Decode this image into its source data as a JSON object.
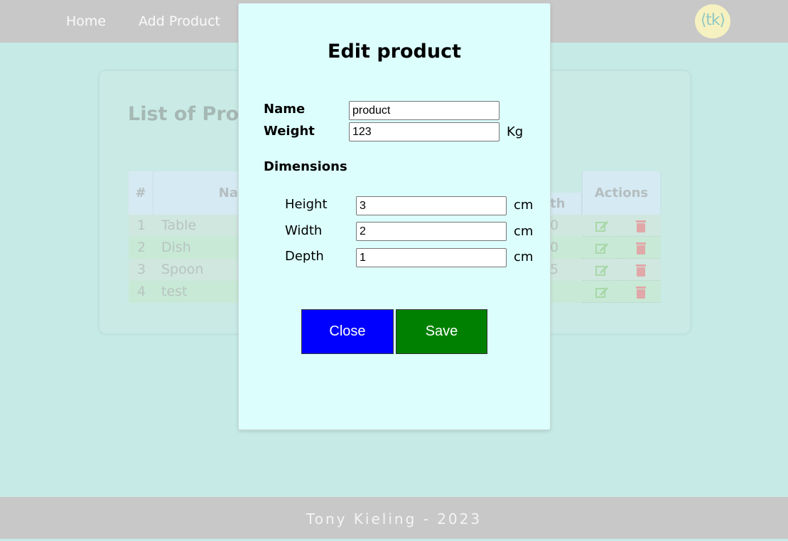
{
  "navbar": {
    "links": [
      "Home",
      "Add Product"
    ],
    "logo_text": "⟨tk⟩"
  },
  "background_page": {
    "title": "List of Prod",
    "table": {
      "headers": [
        "#",
        "Na",
        "th",
        "Actions"
      ],
      "rows": [
        {
          "index": "1",
          "name": "Table",
          "depth": "0"
        },
        {
          "index": "2",
          "name": "Dish",
          "depth": "0"
        },
        {
          "index": "3",
          "name": "Spoon",
          "depth": "5"
        },
        {
          "index": "4",
          "name": "test",
          "depth": ""
        }
      ]
    }
  },
  "modal": {
    "title": "Edit product",
    "name_label": "Name",
    "name_value": "product",
    "weight_label": "Weight",
    "weight_value": "123",
    "weight_unit": "Kg",
    "dimensions_label": "Dimensions",
    "height_label": "Height",
    "height_value": "3",
    "width_label": "Width",
    "width_value": "2",
    "depth_label": "Depth",
    "depth_value": "1",
    "dimension_unit": "cm",
    "close_label": "Close",
    "save_label": "Save"
  },
  "footer": {
    "text": "Tony Kieling - 2023"
  },
  "colors": {
    "close_button": "#0000ff",
    "save_button": "#008000",
    "modal_background": "#dcfffd",
    "page_background": "#c6ebe6"
  }
}
